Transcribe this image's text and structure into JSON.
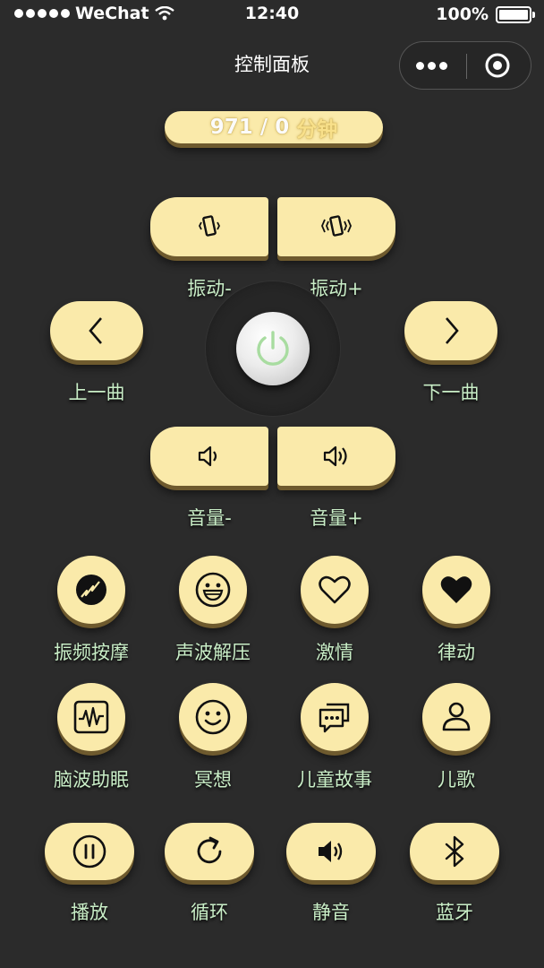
{
  "status_bar": {
    "carrier": "WeChat",
    "time": "12:40",
    "battery": "100%"
  },
  "header": {
    "title": "控制面板"
  },
  "timer": {
    "value": "971 / 0",
    "unit": "分钟"
  },
  "controls": {
    "vibrate_minus": "振动-",
    "vibrate_plus": "振动+",
    "prev": "上一曲",
    "next": "下一曲",
    "volume_minus": "音量-",
    "volume_plus": "音量+"
  },
  "modes_row1": [
    {
      "label": "振频按摩",
      "icon": "spark-ball-icon"
    },
    {
      "label": "声波解压",
      "icon": "grin-face-icon"
    },
    {
      "label": "激情",
      "icon": "heart-outline-icon"
    },
    {
      "label": "律动",
      "icon": "heart-filled-icon"
    }
  ],
  "modes_row2": [
    {
      "label": "脑波助眠",
      "icon": "wave-monitor-icon"
    },
    {
      "label": "冥想",
      "icon": "smile-face-icon"
    },
    {
      "label": "儿童故事",
      "icon": "chat-bubble-icon"
    },
    {
      "label": "儿歌",
      "icon": "person-icon"
    }
  ],
  "bottom_row": [
    {
      "label": "播放",
      "icon": "pause-circle-icon"
    },
    {
      "label": "循环",
      "icon": "refresh-icon"
    },
    {
      "label": "静音",
      "icon": "speaker-icon"
    },
    {
      "label": "蓝牙",
      "icon": "bluetooth-icon"
    }
  ],
  "colors": {
    "background": "#2b2b2b",
    "button": "#faeaaa",
    "label": "#c9eec7",
    "shadow": "#6e5a2e"
  }
}
